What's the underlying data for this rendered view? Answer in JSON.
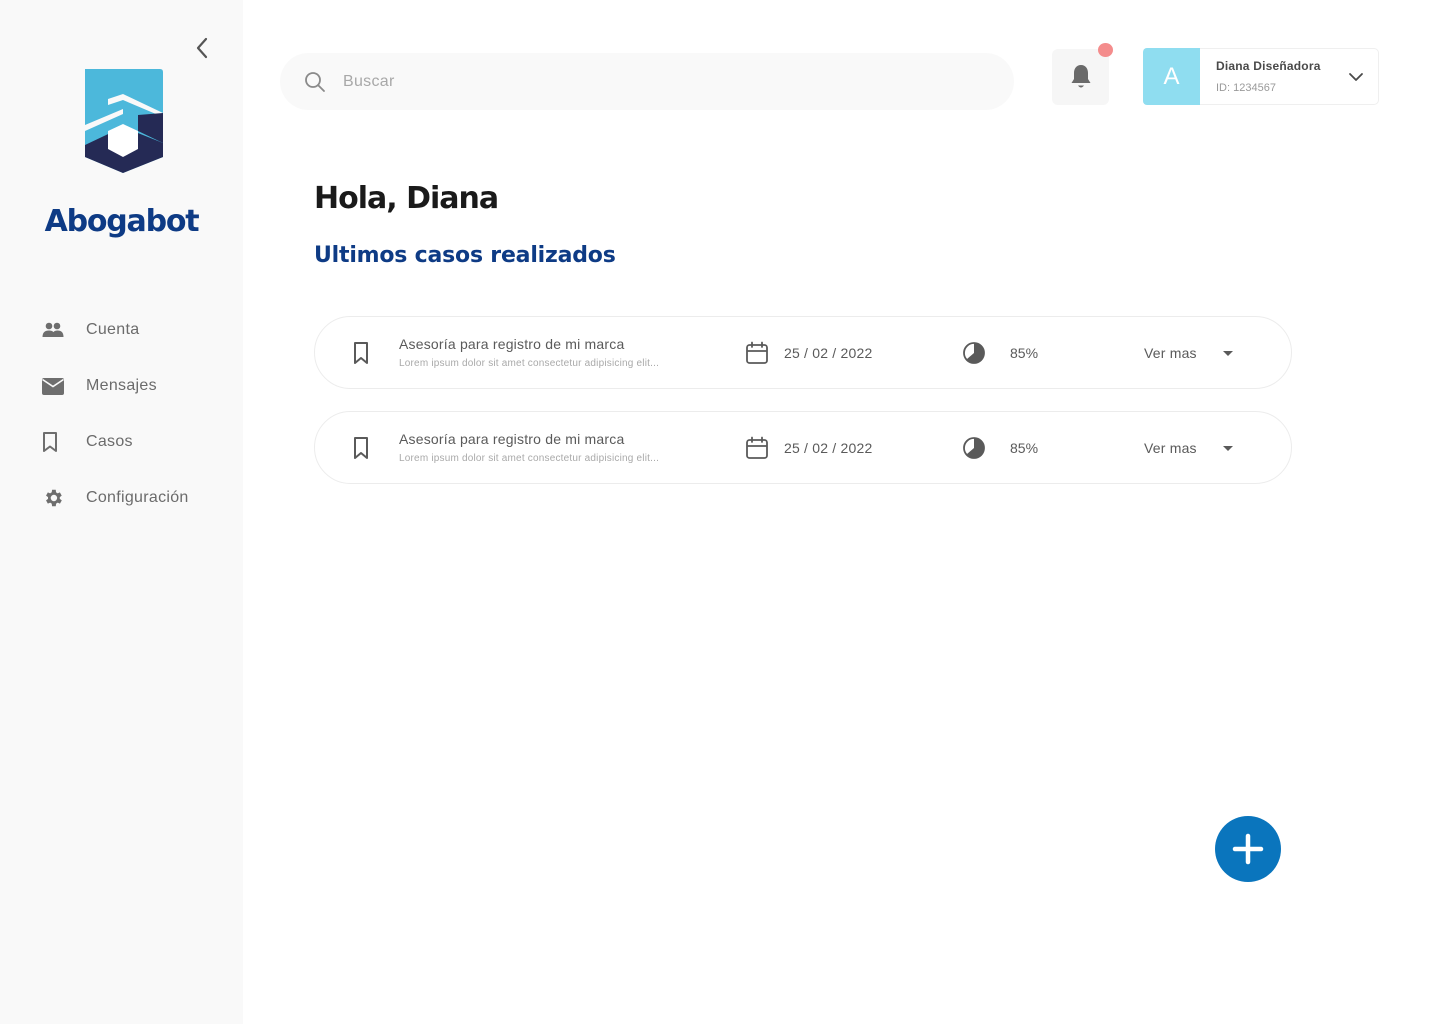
{
  "sidebar": {
    "brand": "Abogabot",
    "items": [
      {
        "label": "Cuenta",
        "icon": "people-icon"
      },
      {
        "label": "Mensajes",
        "icon": "mail-icon"
      },
      {
        "label": "Casos",
        "icon": "bookmark-icon"
      },
      {
        "label": "Configuración",
        "icon": "gear-icon"
      }
    ]
  },
  "header": {
    "search_placeholder": "Buscar",
    "notification_badge_color": "#f48c8c",
    "user": {
      "avatar_letter": "A",
      "name": "Diana Diseñadora",
      "id": "ID: 1234567"
    }
  },
  "main": {
    "greeting": "Hola, Diana",
    "section_title": "Ultimos casos realizados",
    "cases": [
      {
        "title": "Asesoría para registro de mi marca",
        "description": "Lorem ipsum dolor sit amet consectetur adipisicing elit...",
        "date": "25 / 02 / 2022",
        "progress": "85%",
        "more_label": "Ver mas"
      },
      {
        "title": "Asesoría para registro de mi marca",
        "description": "Lorem ipsum dolor sit amet consectetur adipisicing elit...",
        "date": "25 / 02 / 2022",
        "progress": "85%",
        "more_label": "Ver mas"
      }
    ]
  },
  "colors": {
    "brand_blue": "#0e3b85",
    "logo_light": "#4cb8db",
    "logo_dark": "#252a55",
    "avatar_bg": "#8fddf0",
    "fab": "#0a75bd"
  }
}
